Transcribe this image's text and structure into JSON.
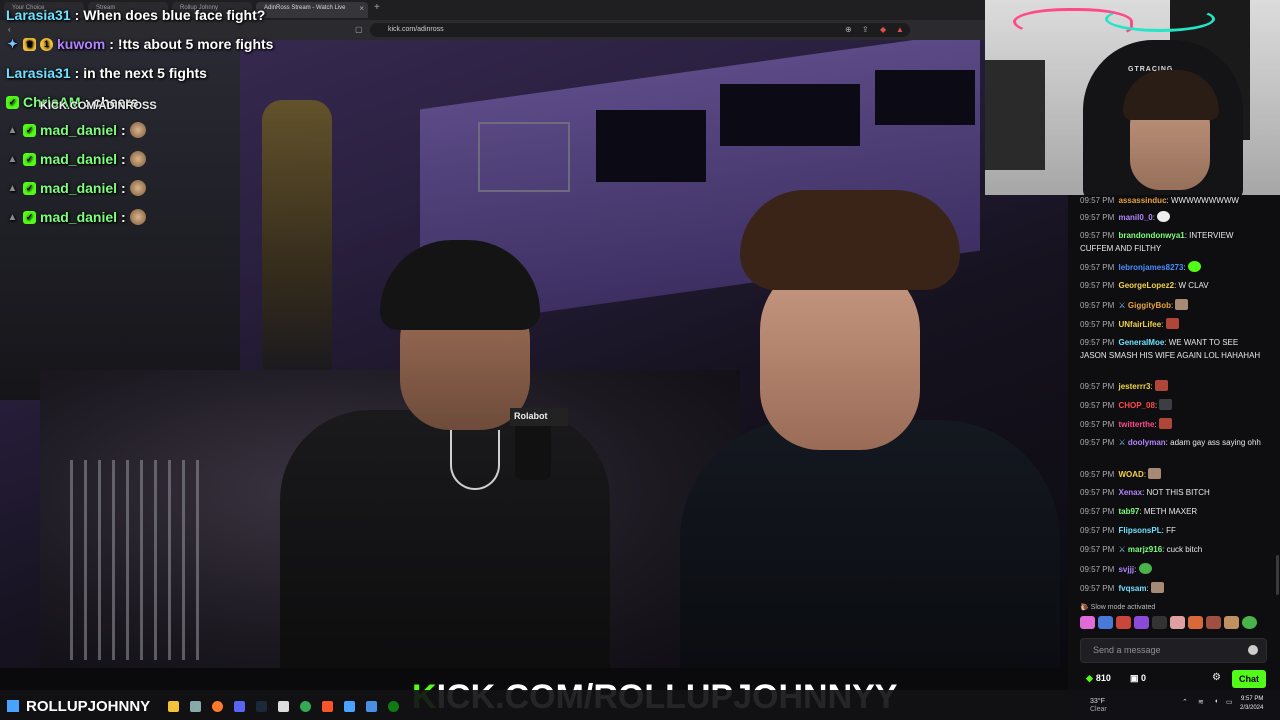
{
  "browser": {
    "tabs": [
      "Your Choice",
      "Stream",
      "Rollup Johnny",
      "AdinRoss Stream - Watch Live"
    ],
    "tab_close": "×",
    "new_tab": "+",
    "url": "kick.com/adinross"
  },
  "overlay": {
    "watermark": "KICK.COM/ADINROSS",
    "lines": [
      {
        "user": "Larasia31",
        "text": "When does blue face fight?"
      },
      {
        "user": "kuwom",
        "badge": "1",
        "text": "!tts about 5 more fights"
      },
      {
        "user": "Larasia31",
        "text": "in the next 5 fights"
      },
      {
        "user": "ChrisAM",
        "text": "cheers"
      },
      {
        "user": "mad_daniel",
        "text": ""
      },
      {
        "user": "mad_daniel",
        "text": ""
      },
      {
        "user": "mad_daniel",
        "text": ""
      },
      {
        "user": "mad_daniel",
        "text": ""
      }
    ]
  },
  "video": {
    "mic_flag": "Rolabot"
  },
  "webcam": {
    "chair_brand": "GTRACING"
  },
  "chat": {
    "messages": [
      {
        "time": "09:57 PM",
        "user": "assassinduc",
        "color": "#e6a23c",
        "text": "WWWWWWWWW"
      },
      {
        "time": "09:57 PM",
        "user": "manil0_0",
        "color": "#b283ff",
        "text": ""
      },
      {
        "time": "09:57 PM",
        "user": "brandondonwya1",
        "color": "#7cff7c",
        "text": "INTERVIEW CUFFEM AND FILTHY"
      },
      {
        "time": "09:57 PM",
        "user": "lebronjames8273",
        "color": "#4a8cff",
        "text": ""
      },
      {
        "time": "09:57 PM",
        "user": "GeorgeLopez2",
        "color": "#f3d34a",
        "text": "W CLAV"
      },
      {
        "time": "09:57 PM",
        "user": "GiggityBob",
        "color": "#e6a23c",
        "text": ""
      },
      {
        "time": "09:57 PM",
        "user": "UNfairLifee",
        "color": "#f3d34a",
        "text": ""
      },
      {
        "time": "09:57 PM",
        "user": "GeneralMoe",
        "color": "#6fe0ff",
        "text": "WE WANT TO SEE JASON SMASH HIS WIFE AGAIN LOL HAHAHAH"
      },
      {
        "time": "09:57 PM",
        "user": "jesterrr3",
        "color": "#f3d34a",
        "text": ""
      },
      {
        "time": "09:57 PM",
        "user": "CHOP_08",
        "color": "#ff4a4a",
        "text": ""
      },
      {
        "time": "09:57 PM",
        "user": "twitterthe",
        "color": "#ff4a8a",
        "text": ""
      },
      {
        "time": "09:57 PM",
        "user": "doolyman",
        "color": "#b283ff",
        "text": "adam gay ass saying ohh"
      },
      {
        "time": "09:57 PM",
        "user": "WOAD",
        "color": "#f3d34a",
        "text": ""
      },
      {
        "time": "09:57 PM",
        "user": "Xenax",
        "color": "#b283ff",
        "text": "NOT THIS BITCH"
      },
      {
        "time": "09:57 PM",
        "user": "tab97",
        "color": "#7cff7c",
        "text": "METH MAXER"
      },
      {
        "time": "09:57 PM",
        "user": "FlipsonsPL",
        "color": "#6fe0ff",
        "text": "FF"
      },
      {
        "time": "09:57 PM",
        "user": "marjz916",
        "color": "#7cff7c",
        "text": "cuck bitch"
      },
      {
        "time": "09:57 PM",
        "user": "svjjj",
        "color": "#b283ff",
        "text": ""
      },
      {
        "time": "09:57 PM",
        "user": "fvqsam",
        "color": "#6fe0ff",
        "text": ""
      }
    ],
    "slow_mode": "Slow mode activated",
    "send_placeholder": "Send a message",
    "points": "810",
    "gifts": "0",
    "chat_button": "Chat"
  },
  "banner": {
    "k": "K",
    "rest": "ICK.COM/ROLLUPJOHNNYY"
  },
  "taskbar": {
    "name": "ROLLUPJOHNNY",
    "weather_temp": "33°F",
    "weather_desc": "Clear",
    "time": "9:57 PM",
    "date": "2/3/2024"
  },
  "colors": {
    "kick_green": "#53fc18",
    "chat_bg": "#0e0e10"
  }
}
